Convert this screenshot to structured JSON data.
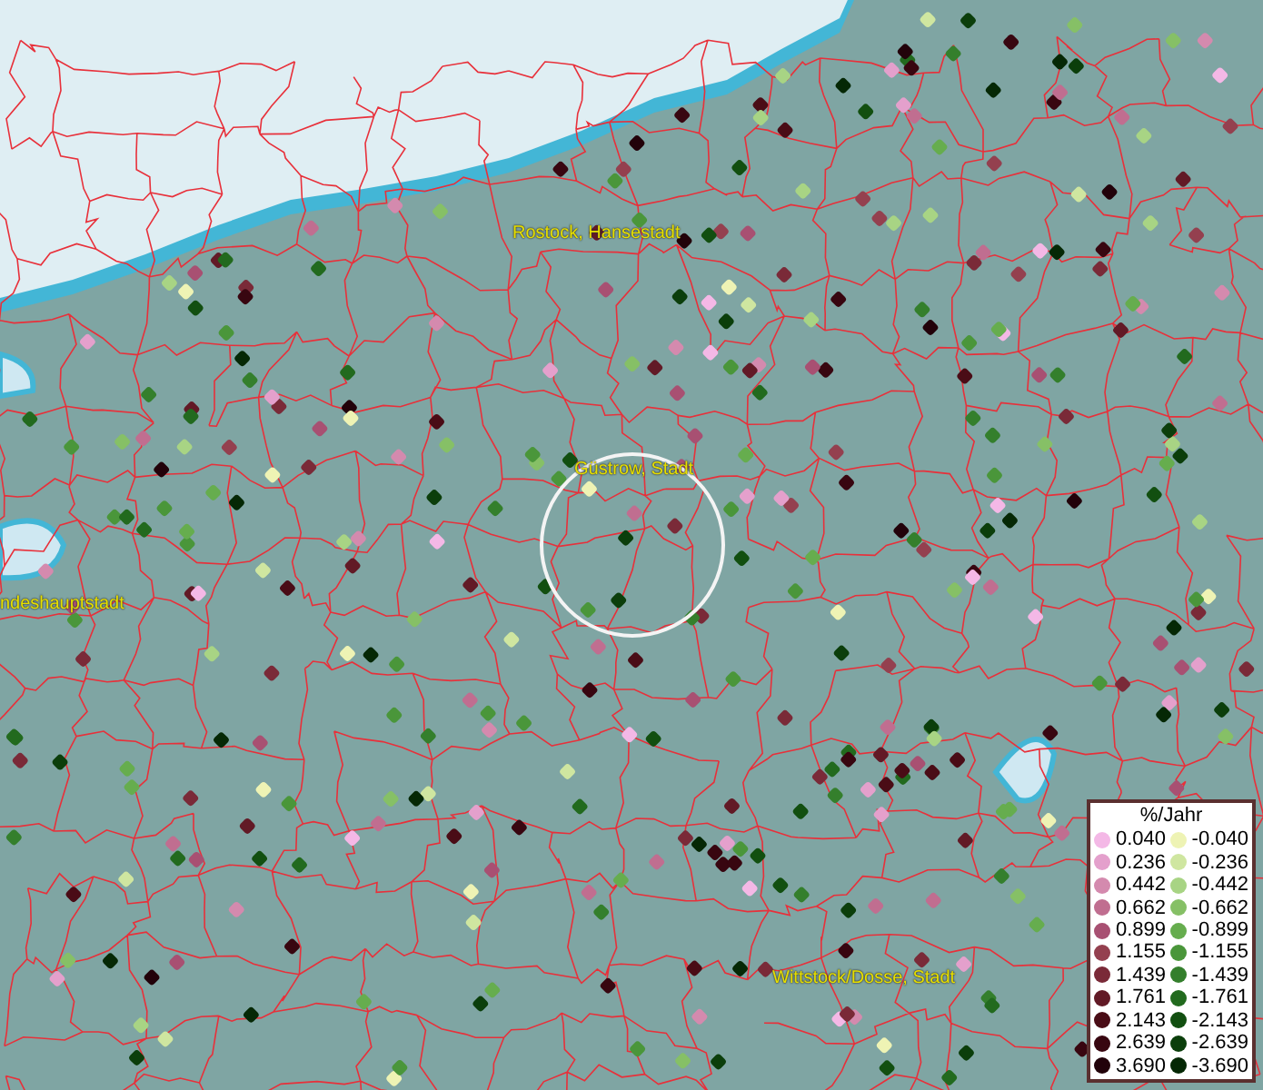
{
  "map": {
    "places": [
      {
        "label": "Rostock, Hansestadt"
      },
      {
        "label": "Güstrow, Stadt"
      },
      {
        "label": "ndeshauptstadt"
      },
      {
        "label": "Wittstock/Dosse, Stadt"
      }
    ]
  },
  "legend": {
    "title": "%/Jahr",
    "rows": [
      {
        "positive": {
          "label": "0.040",
          "color": "#f4b8e6"
        },
        "negative": {
          "label": "-0.040",
          "color": "#eef3b4"
        }
      },
      {
        "positive": {
          "label": "0.236",
          "color": "#e4a0cc"
        },
        "negative": {
          "label": "-0.236",
          "color": "#cfe6a0"
        }
      },
      {
        "positive": {
          "label": "0.442",
          "color": "#d48aae"
        },
        "negative": {
          "label": "-0.442",
          "color": "#a8d484"
        }
      },
      {
        "positive": {
          "label": "0.662",
          "color": "#c06e90"
        },
        "negative": {
          "label": "-0.662",
          "color": "#86c066"
        }
      },
      {
        "positive": {
          "label": "0.899",
          "color": "#a85072"
        },
        "negative": {
          "label": "-0.899",
          "color": "#66ad4e"
        }
      },
      {
        "positive": {
          "label": "1.155",
          "color": "#94404f"
        },
        "negative": {
          "label": "-1.155",
          "color": "#4a963a"
        }
      },
      {
        "positive": {
          "label": "1.439",
          "color": "#7a2a38"
        },
        "negative": {
          "label": "-1.439",
          "color": "#347f2c"
        }
      },
      {
        "positive": {
          "label": "1.761",
          "color": "#621a26"
        },
        "negative": {
          "label": "-1.761",
          "color": "#226a1e"
        }
      },
      {
        "positive": {
          "label": "2.143",
          "color": "#4a0c16"
        },
        "negative": {
          "label": "-2.143",
          "color": "#124f10"
        }
      },
      {
        "positive": {
          "label": "2.639",
          "color": "#380610"
        },
        "negative": {
          "label": "-2.639",
          "color": "#0b3e0b"
        }
      },
      {
        "positive": {
          "label": "3.690",
          "color": "#22020a"
        },
        "negative": {
          "label": "-3.690",
          "color": "#052805"
        }
      }
    ]
  }
}
